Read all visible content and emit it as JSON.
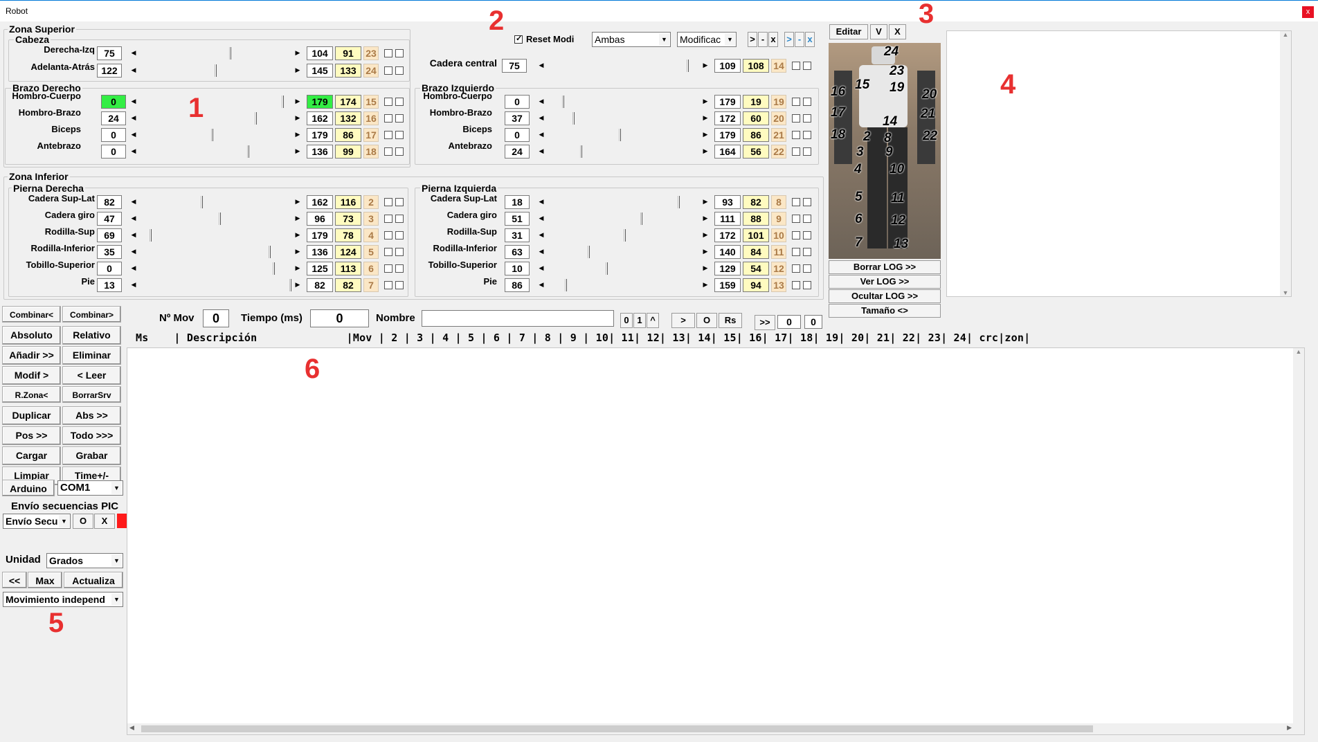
{
  "window": {
    "title": "Robot",
    "close": "x"
  },
  "annotations": [
    "1",
    "2",
    "3",
    "4",
    "5",
    "6"
  ],
  "zona_superior": {
    "title": "Zona Superior",
    "cabeza": "Cabeza",
    "brazo_derecho": "Brazo Derecho",
    "brazo_izquierdo": "Brazo Izquierdo",
    "cadera_central": "Cadera central"
  },
  "zona_inferior": {
    "title": "Zona Inferior",
    "pierna_derecha": "Pierna Derecha",
    "pierna_izquierda": "Pierna Izquierda"
  },
  "servos": {
    "cabeza": [
      {
        "label": "Derecha-Izq",
        "value": "75",
        "max": "104",
        "cur": "91",
        "id": "23",
        "pos": 0.6
      },
      {
        "label": "Adelanta-Atrás",
        "value": "122",
        "max": "145",
        "cur": "133",
        "id": "24",
        "pos": 0.5
      }
    ],
    "cadera": [
      {
        "label": "Cadera central",
        "value": "75",
        "max": "109",
        "cur": "108",
        "id": "14",
        "pos": 0.93
      }
    ],
    "brazo_der": [
      {
        "label": "Hombro-Cuerpo",
        "value": "0",
        "max": "179",
        "cur": "174",
        "id": "15",
        "pos": 0.95,
        "green": true
      },
      {
        "label": "Hombro-Brazo",
        "value": "24",
        "max": "162",
        "cur": "132",
        "id": "16",
        "pos": 0.77
      },
      {
        "label": "Biceps",
        "value": "0",
        "max": "179",
        "cur": "86",
        "id": "17",
        "pos": 0.48
      },
      {
        "label": "Antebrazo",
        "value": "0",
        "max": "136",
        "cur": "99",
        "id": "18",
        "pos": 0.72
      }
    ],
    "brazo_izq": [
      {
        "label": "Hombro-Cuerpo",
        "value": "0",
        "max": "179",
        "cur": "19",
        "id": "19",
        "pos": 0.1
      },
      {
        "label": "Hombro-Brazo",
        "value": "37",
        "max": "172",
        "cur": "60",
        "id": "20",
        "pos": 0.17
      },
      {
        "label": "Biceps",
        "value": "0",
        "max": "179",
        "cur": "86",
        "id": "21",
        "pos": 0.48
      },
      {
        "label": "Antebrazo",
        "value": "24",
        "max": "164",
        "cur": "56",
        "id": "22",
        "pos": 0.22
      }
    ],
    "pierna_der": [
      {
        "label": "Cadera Sup-Lat",
        "value": "82",
        "max": "162",
        "cur": "116",
        "id": "2",
        "pos": 0.41
      },
      {
        "label": "Cadera giro",
        "value": "47",
        "max": "96",
        "cur": "73",
        "id": "3",
        "pos": 0.53
      },
      {
        "label": "Rodilla-Sup",
        "value": "69",
        "max": "179",
        "cur": "78",
        "id": "4",
        "pos": 0.07
      },
      {
        "label": "Rodilla-Inferior",
        "value": "35",
        "max": "136",
        "cur": "124",
        "id": "5",
        "pos": 0.86
      },
      {
        "label": "Tobillo-Superior",
        "value": "0",
        "max": "125",
        "cur": "113",
        "id": "6",
        "pos": 0.89
      },
      {
        "label": "Pie",
        "value": "13",
        "max": "82",
        "cur": "82",
        "id": "7",
        "pos": 1.0
      }
    ],
    "pierna_izq": [
      {
        "label": "Cadera Sup-Lat",
        "value": "18",
        "max": "93",
        "cur": "82",
        "id": "8",
        "pos": 0.87
      },
      {
        "label": "Cadera giro",
        "value": "51",
        "max": "111",
        "cur": "88",
        "id": "9",
        "pos": 0.62
      },
      {
        "label": "Rodilla-Sup",
        "value": "31",
        "max": "172",
        "cur": "101",
        "id": "10",
        "pos": 0.51
      },
      {
        "label": "Rodilla-Inferior",
        "value": "63",
        "max": "140",
        "cur": "84",
        "id": "11",
        "pos": 0.27
      },
      {
        "label": "Tobillo-Superior",
        "value": "10",
        "max": "129",
        "cur": "54",
        "id": "12",
        "pos": 0.39
      },
      {
        "label": "Pie",
        "value": "86",
        "max": "159",
        "cur": "94",
        "id": "13",
        "pos": 0.12
      }
    ]
  },
  "top_controls": {
    "reset_modi": "Reset Modi",
    "reset_checked": true,
    "side_combo": "Ambas",
    "mode_combo": "Modificac",
    "nav_btns": [
      ">",
      "-",
      "x",
      ">",
      "-",
      "x"
    ]
  },
  "photo_panel": {
    "editar": "Editar",
    "v": "V",
    "x": "X",
    "numbers": [
      "24",
      "23",
      "15",
      "19",
      "16",
      "20",
      "17",
      "21",
      "18",
      "22",
      "14",
      "2",
      "8",
      "3",
      "9",
      "4",
      "10",
      "5",
      "11",
      "6",
      "12",
      "7",
      "13"
    ],
    "log_buttons": [
      "Borrar LOG >>",
      "Ver LOG >>",
      "Ocultar LOG >>",
      "Tamaño <>"
    ]
  },
  "left_buttons": [
    [
      "Combinar<",
      "Combinar>"
    ],
    [
      "Absoluto",
      "Relativo"
    ],
    [
      "Añadir >>",
      "Eliminar"
    ],
    [
      "Modif >",
      "< Leer"
    ],
    [
      "R.Zona<",
      "BorrarSrv"
    ],
    [
      "Duplicar",
      "Abs >>"
    ],
    [
      "Pos >>",
      "Todo >>>"
    ],
    [
      "Cargar",
      "Grabar"
    ],
    [
      "Limpiar",
      "Time+/-"
    ]
  ],
  "arduino": {
    "label": "Arduino",
    "port": "COM1"
  },
  "pic": {
    "title": "Envío secuencias PIC",
    "combo": "Envío Secu",
    "o": "O",
    "x": "X"
  },
  "unidad": {
    "label": "Unidad",
    "value": "Grados"
  },
  "bottom_btns": [
    "<<",
    "Max",
    "Actualiza"
  ],
  "movimiento": "Movimiento independ",
  "sequence": {
    "nmov_label": "Nº Mov",
    "nmov": "0",
    "tiempo_label": "Tiempo (ms)",
    "tiempo": "0",
    "nombre_label": "Nombre",
    "nombre": "",
    "btns": [
      "0",
      "1",
      "^",
      ">",
      "O",
      "Rs"
    ],
    "fwd": ">>",
    "f1": "0",
    "f2": "0"
  },
  "header_row": "Ms    | Descripción              |Mov | 2 | 3 | 4 | 5 | 6 | 7 | 8 | 9 | 10| 11| 12| 13| 14| 15| 16| 17| 18| 19| 20| 21| 22| 23| 24| crc|zon|"
}
